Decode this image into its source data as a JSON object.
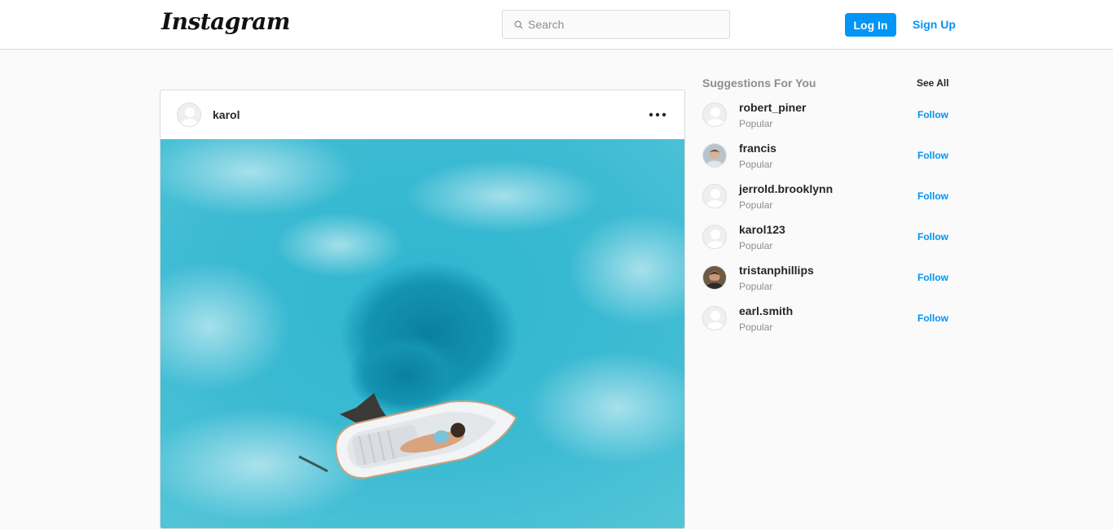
{
  "header": {
    "logo_text": "Instagram",
    "search_placeholder": "Search",
    "login_label": "Log In",
    "signup_label": "Sign Up"
  },
  "post": {
    "username": "karol",
    "more_icon": "more-horizontal-icon"
  },
  "suggestions": {
    "title": "Suggestions For You",
    "see_all": "See All",
    "items": [
      {
        "username": "robert_piner",
        "subtitle": "Popular",
        "follow": "Follow",
        "avatar": "default"
      },
      {
        "username": "francis",
        "subtitle": "Popular",
        "follow": "Follow",
        "avatar": "photo"
      },
      {
        "username": "jerrold.brooklynn",
        "subtitle": "Popular",
        "follow": "Follow",
        "avatar": "default"
      },
      {
        "username": "karol123",
        "subtitle": "Popular",
        "follow": "Follow",
        "avatar": "default"
      },
      {
        "username": "tristanphillips",
        "subtitle": "Popular",
        "follow": "Follow",
        "avatar": "photo"
      },
      {
        "username": "earl.smith",
        "subtitle": "Popular",
        "follow": "Follow",
        "avatar": "default"
      }
    ]
  },
  "colors": {
    "accent": "#0095f6",
    "border": "#dbdbdb",
    "background": "#fafafa",
    "muted_text": "#8e8e8e"
  }
}
